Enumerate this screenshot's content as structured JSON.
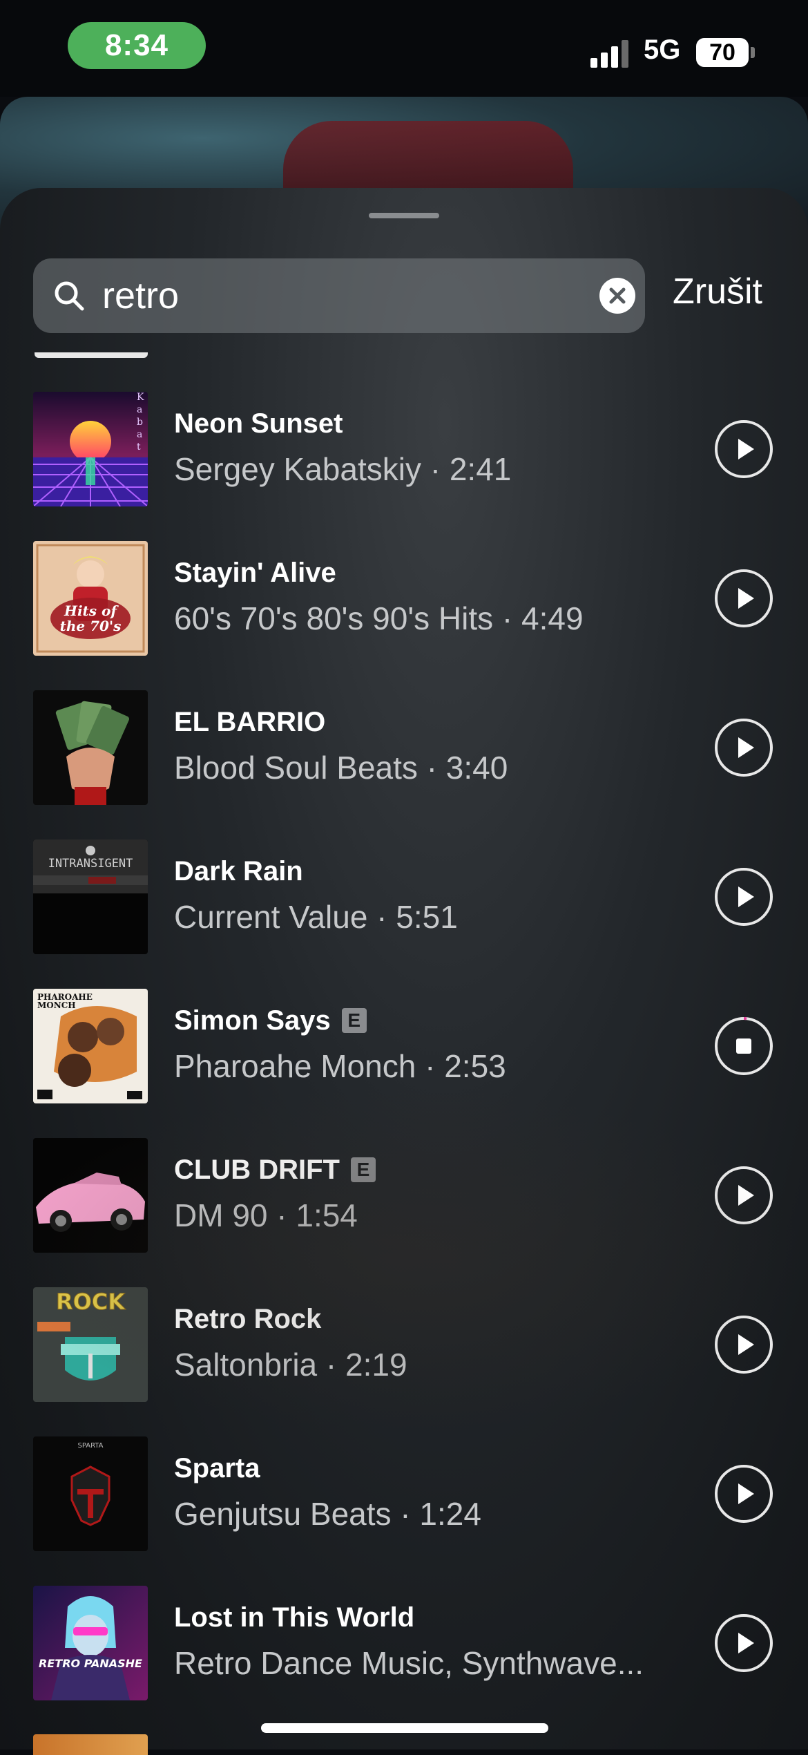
{
  "status_bar": {
    "time": "8:34",
    "network": "5G",
    "battery": "70"
  },
  "search": {
    "query": "retro",
    "cancel_label": "Zrušit"
  },
  "tracks": [
    {
      "title": "Neon Sunset",
      "explicit": false,
      "meta": "Sergey Kabatskiy · 2:41",
      "playing": false,
      "art_text": "Kabatsky"
    },
    {
      "title": "Stayin' Alive",
      "explicit": false,
      "meta": "60's 70's 80's 90's Hits · 4:49",
      "playing": false,
      "art_text": "Hits of the 70's"
    },
    {
      "title": "EL BARRIO",
      "explicit": false,
      "meta": "Blood Soul Beats · 3:40",
      "playing": false,
      "art_text": ""
    },
    {
      "title": "Dark Rain",
      "explicit": false,
      "meta": "Current Value · 5:51",
      "playing": false,
      "art_text": "INTRANSIGENT"
    },
    {
      "title": "Simon Says",
      "explicit": true,
      "meta": "Pharoahe Monch · 2:53",
      "playing": true,
      "art_text": "PHAROAHE MONCH"
    },
    {
      "title": "CLUB DRIFT",
      "explicit": true,
      "meta": "DM 90 · 1:54",
      "playing": false,
      "art_text": ""
    },
    {
      "title": "Retro Rock",
      "explicit": false,
      "meta": "Saltonbria · 2:19",
      "playing": false,
      "art_text": "ROCK"
    },
    {
      "title": "Sparta",
      "explicit": false,
      "meta": "Genjutsu Beats · 1:24",
      "playing": false,
      "art_text": "SPARTA"
    },
    {
      "title": "Lost in This World",
      "explicit": false,
      "meta": "Retro Dance Music, Synthwave...",
      "playing": false,
      "art_text": "RETRO PANASHE"
    }
  ],
  "explicit_badge": "E",
  "icons": {
    "search": "search-icon",
    "clear": "clear-circle-icon",
    "play": "play-circle-icon",
    "stop": "stop-circle-icon"
  }
}
